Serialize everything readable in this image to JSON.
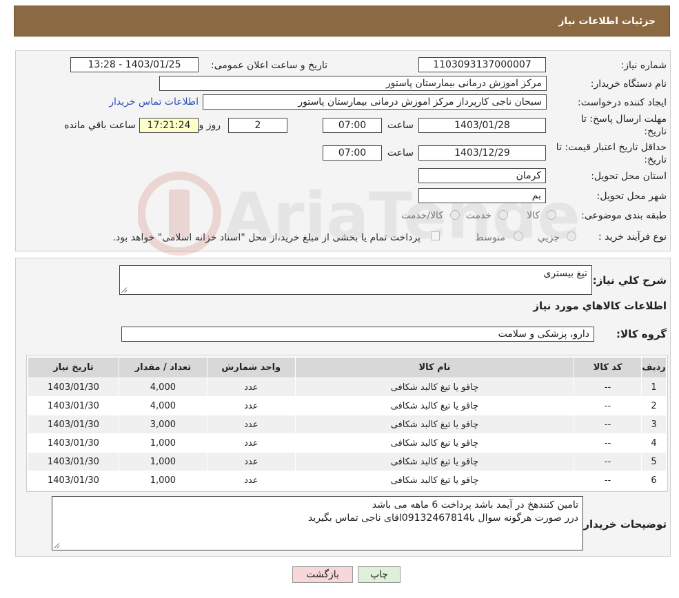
{
  "header": {
    "title": "جزئیات اطلاعات نیاز"
  },
  "form": {
    "need_number_label": "شماره نیاز:",
    "need_number": "1103093137000007",
    "announce_label": "تاریخ و ساعت اعلان عمومی:",
    "announce_value": "1403/01/25 - 13:28",
    "buyer_org_label": "نام دستگاه خریدار:",
    "buyer_org": "مرکز اموزش درمانی بیمارستان پاستور",
    "creator_label": "ایجاد کننده درخواست:",
    "creator": "سبحان ناجی کارپرداز مرکز اموزش درمانی بیمارستان پاستور",
    "contact_link": "اطلاعات تماس خریدار",
    "deadline_label": "مهلت ارسال پاسخ: تا تاریخ:",
    "deadline_date": "1403/01/28",
    "hour_label": "ساعت",
    "deadline_time": "07:00",
    "days_value": "2",
    "days_label": "روز و",
    "remaining_time": "17:21:24",
    "remaining_label": "ساعت باقي مانده",
    "price_validity_label": "حداقل تاریخ اعتبار قیمت: تا تاریخ:",
    "price_validity_date": "1403/12/29",
    "price_validity_time": "07:00",
    "province_label": "استان محل تحویل:",
    "province": "کرمان",
    "city_label": "شهر محل تحویل:",
    "city": "بم",
    "category_label": "طبقه بندی موضوعی:",
    "category_options": [
      "کالا",
      "خدمت",
      "کالا/خدمت"
    ],
    "purchase_type_label": "نوع فرآیند خرید :",
    "purchase_options": [
      "جزیي",
      "متوسط"
    ],
    "payment_note": "پرداخت تمام یا بخشی از مبلغ خرید،از محل \"اسناد خزانه اسلامی\" خواهد بود."
  },
  "details": {
    "summary_label": "شرح کلي نياز:",
    "summary": "تیغ بیستری",
    "goods_info_title": "اطلاعات کالاهاي مورد نياز",
    "group_label": "گروه کالا:",
    "group": "دارو، پزشکی و سلامت"
  },
  "table": {
    "headers": [
      "رديف",
      "کد کالا",
      "نام کالا",
      "واحد شمارش",
      "تعداد / مقدار",
      "تاریخ نیاز"
    ],
    "rows": [
      [
        "1",
        "--",
        "چاقو یا تیغ کالبد شکافی",
        "عدد",
        "4,000",
        "1403/01/30"
      ],
      [
        "2",
        "--",
        "چاقو یا تیغ کالبد شکافی",
        "عدد",
        "4,000",
        "1403/01/30"
      ],
      [
        "3",
        "--",
        "چاقو یا تیغ کالبد شکافی",
        "عدد",
        "3,000",
        "1403/01/30"
      ],
      [
        "4",
        "--",
        "چاقو یا تیغ کالبد شکافی",
        "عدد",
        "1,000",
        "1403/01/30"
      ],
      [
        "5",
        "--",
        "چاقو یا تیغ کالبد شکافی",
        "عدد",
        "1,000",
        "1403/01/30"
      ],
      [
        "6",
        "--",
        "چاقو یا تیغ کالبد شکافی",
        "عدد",
        "1,000",
        "1403/01/30"
      ]
    ]
  },
  "buyer_notes": {
    "label": "توضیحات خریدار:",
    "line1": "تامین کنندهخ در آیمد باشد پرداخت 6 ماهه می باشد",
    "line2": "درر صورت هرگونه سوال با09132467814اقای ناجی تماس بگیرید"
  },
  "buttons": {
    "print": "چاپ",
    "back": "بازگشت"
  },
  "watermark": {
    "text": "AriaTender.neT"
  },
  "colors": {
    "header": "#8b6a43",
    "print_btn": "#dff0d8",
    "back_btn": "#f8d7da",
    "link": "#2d4fbf"
  }
}
